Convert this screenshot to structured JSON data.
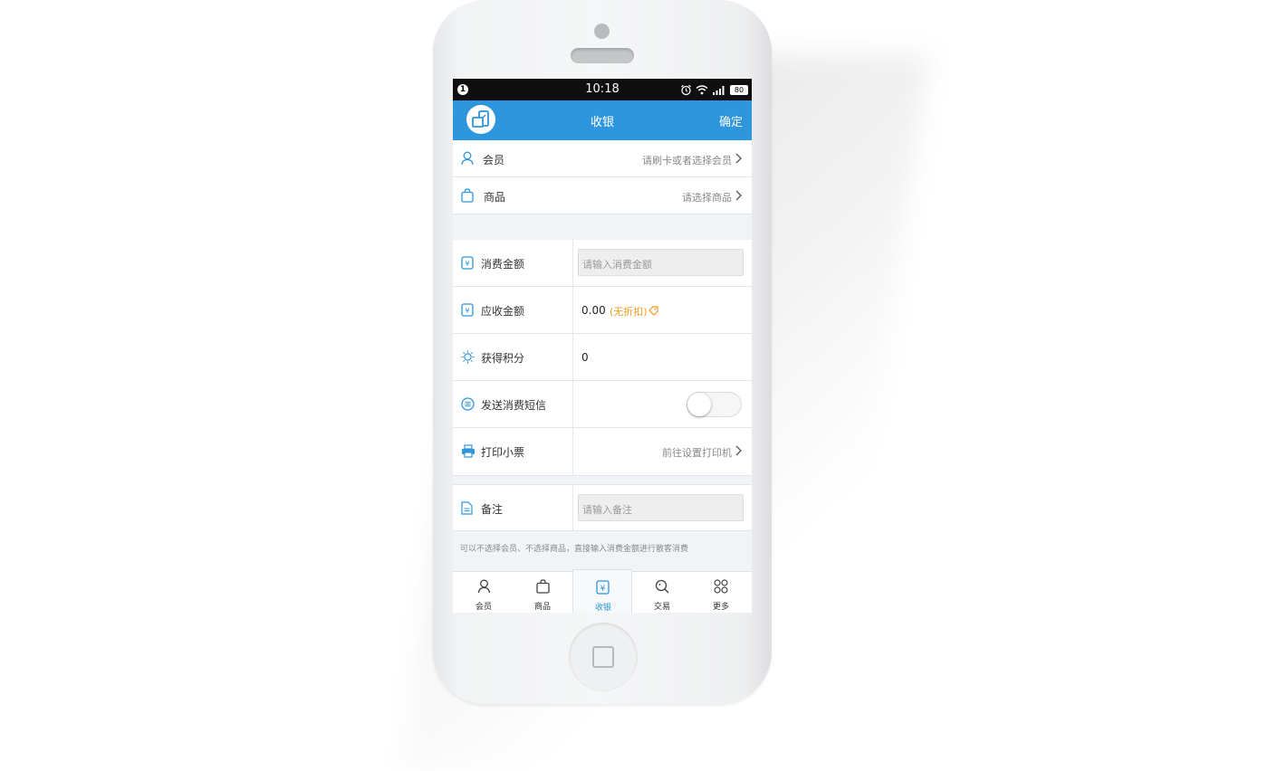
{
  "status_bar": {
    "notification_badge": "1",
    "time": "10:18",
    "battery": "80"
  },
  "nav": {
    "title": "收银",
    "confirm_label": "确定"
  },
  "selectors": [
    {
      "label": "会员",
      "hint": "请刷卡或者选择会员",
      "icon": "user-icon"
    },
    {
      "label": "商品",
      "hint": "请选择商品",
      "icon": "shopping-bag-icon"
    }
  ],
  "form": {
    "consume_amount": {
      "label": "消费金额",
      "placeholder": "请输入消费金额",
      "icon": "yuan-icon"
    },
    "receivable": {
      "label": "应收金额",
      "value": "0.00",
      "discount": "(无折扣)",
      "icon": "yuan-icon"
    },
    "points": {
      "label": "获得积分",
      "value": "0",
      "icon": "points-icon"
    },
    "sms": {
      "label": "发送消费短信",
      "enabled": false,
      "icon": "message-icon"
    },
    "print": {
      "label": "打印小票",
      "hint": "前往设置打印机",
      "icon": "printer-icon"
    },
    "remark": {
      "label": "备注",
      "placeholder": "请输入备注",
      "icon": "document-icon"
    }
  },
  "footnote": "可以不选择会员、不选择商品，直接输入消费金额进行散客消费",
  "tabs": [
    {
      "label": "会员",
      "icon": "user-icon",
      "active": false
    },
    {
      "label": "商品",
      "icon": "shopping-bag-icon",
      "active": false
    },
    {
      "label": "收银",
      "icon": "yuan-icon",
      "active": true
    },
    {
      "label": "交易",
      "icon": "search-icon",
      "active": false
    },
    {
      "label": "更多",
      "icon": "grid-icon",
      "active": false
    }
  ],
  "colors": {
    "primary": "#2d96dc",
    "accent_orange": "#f29a1f",
    "background": "#f1f4f7"
  }
}
